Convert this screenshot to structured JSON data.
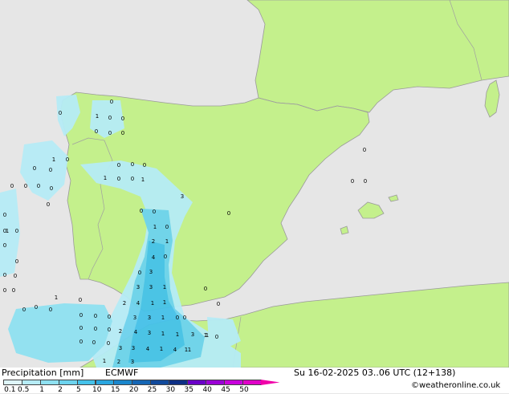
{
  "footer": {
    "title": "Precipitation [mm]",
    "model": "ECMWF",
    "datetime": "Su 16-02-2025 03..06 UTC (12+138)",
    "credit": "©weatheronline.co.uk"
  },
  "legend": {
    "labels": [
      "0.1",
      "0.5",
      "1",
      "2",
      "5",
      "10",
      "15",
      "20",
      "25",
      "30",
      "35",
      "40",
      "45",
      "50"
    ],
    "colors": [
      "#dff6fb",
      "#b6ecf6",
      "#8fe1f1",
      "#6dd3ee",
      "#45c2ea",
      "#2aa6e0",
      "#1a86cc",
      "#1566b5",
      "#114a9c",
      "#0d2f86",
      "#6a00c8",
      "#9b00d6",
      "#c800dc",
      "#e000c8",
      "#f000a8"
    ]
  },
  "map_colors": {
    "sea": "#e6e6e6",
    "land": "#c4f08c",
    "coast": "#9a9a9a",
    "border": "#a0a0a0"
  },
  "values": [
    {
      "t": "0"
    },
    {
      "t": "0"
    },
    {
      "t": "1"
    },
    {
      "t": "0"
    },
    {
      "t": "0"
    },
    {
      "t": "0"
    },
    {
      "t": "0"
    },
    {
      "t": "0"
    },
    {
      "t": "1"
    },
    {
      "t": "0"
    },
    {
      "t": "0"
    },
    {
      "t": "0"
    },
    {
      "t": "0"
    },
    {
      "t": "0"
    },
    {
      "t": "0"
    },
    {
      "t": "0"
    },
    {
      "t": "1"
    },
    {
      "t": "0"
    },
    {
      "t": "0"
    },
    {
      "t": "1"
    },
    {
      "t": "0"
    },
    {
      "t": "0"
    },
    {
      "t": "3"
    },
    {
      "t": "0"
    },
    {
      "t": "0"
    },
    {
      "t": "0"
    },
    {
      "t": "1"
    },
    {
      "t": "0"
    },
    {
      "t": "2"
    },
    {
      "t": "1"
    },
    {
      "t": "4"
    },
    {
      "t": "0"
    },
    {
      "t": "3"
    },
    {
      "t": "0"
    },
    {
      "t": "3"
    },
    {
      "t": "3"
    },
    {
      "t": "1"
    },
    {
      "t": "2"
    },
    {
      "t": "4"
    },
    {
      "t": "1"
    },
    {
      "t": "1"
    },
    {
      "t": "3"
    },
    {
      "t": "3"
    },
    {
      "t": "1"
    },
    {
      "t": "0"
    },
    {
      "t": "2"
    },
    {
      "t": "4"
    },
    {
      "t": "3"
    },
    {
      "t": "1"
    },
    {
      "t": "1"
    },
    {
      "t": "3"
    },
    {
      "t": "1"
    },
    {
      "t": "3"
    },
    {
      "t": "3"
    },
    {
      "t": "4"
    },
    {
      "t": "1"
    },
    {
      "t": "4"
    },
    {
      "t": "1"
    },
    {
      "t": "1"
    },
    {
      "t": "2"
    },
    {
      "t": "3"
    },
    {
      "t": "0"
    },
    {
      "t": "0"
    },
    {
      "t": "0"
    },
    {
      "t": "0"
    },
    {
      "t": "0"
    },
    {
      "t": "0"
    },
    {
      "t": "0"
    },
    {
      "t": "0"
    },
    {
      "t": "0"
    },
    {
      "t": "0"
    },
    {
      "t": "0"
    },
    {
      "t": "0"
    },
    {
      "t": "0"
    },
    {
      "t": "0"
    },
    {
      "t": "0"
    },
    {
      "t": "0"
    },
    {
      "t": "0"
    },
    {
      "t": "0"
    },
    {
      "t": "0"
    },
    {
      "t": "0"
    },
    {
      "t": "0"
    },
    {
      "t": "0"
    },
    {
      "t": "0"
    },
    {
      "t": "1"
    },
    {
      "t": "0"
    },
    {
      "t": "0"
    },
    {
      "t": "1"
    },
    {
      "t": "0"
    },
    {
      "t": "0"
    },
    {
      "t": "0"
    },
    {
      "t": "0"
    },
    {
      "t": "0"
    },
    {
      "t": "1"
    },
    {
      "t": "1"
    },
    {
      "t": "0"
    }
  ]
}
